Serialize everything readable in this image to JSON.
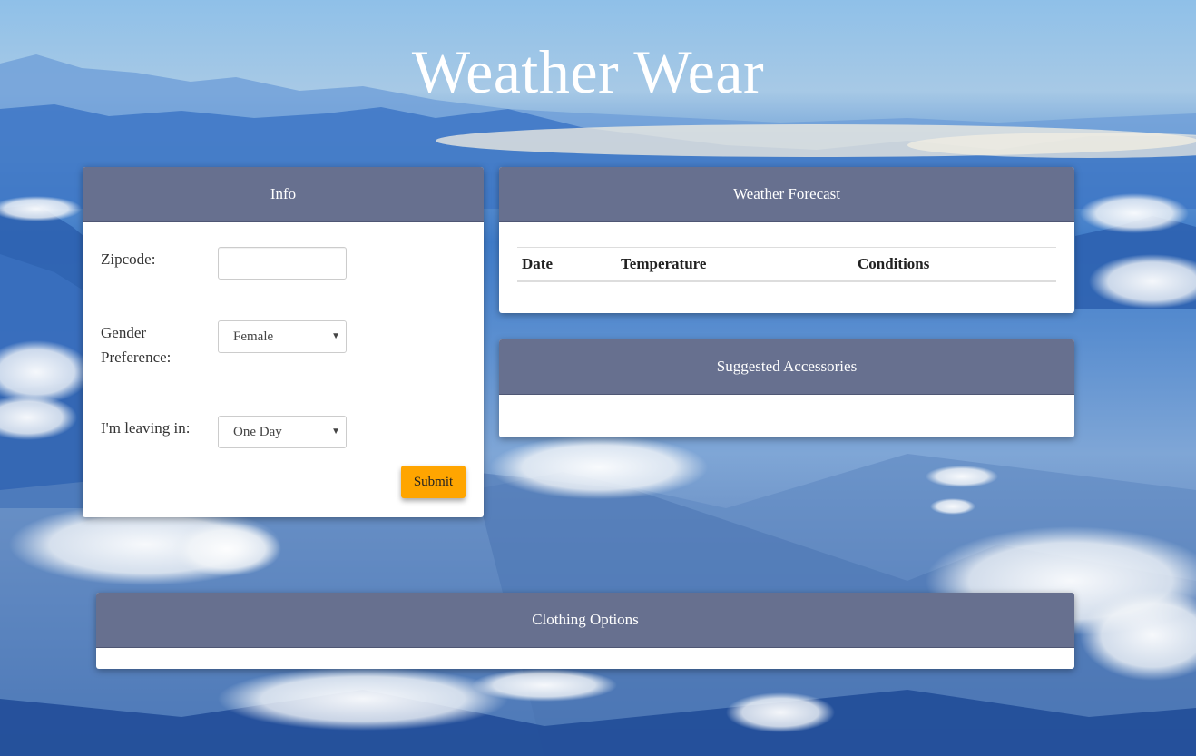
{
  "app": {
    "title": "Weather Wear"
  },
  "info": {
    "header": "Info",
    "zipcode_label": "Zipcode:",
    "zipcode_value": "",
    "gender_label": "Gender Preference:",
    "gender_selected": "Female",
    "leaving_label": "I'm leaving in:",
    "leaving_selected": "One Day",
    "submit_label": "Submit"
  },
  "forecast": {
    "header": "Weather Forecast",
    "columns": [
      "Date",
      "Temperature",
      "Conditions"
    ]
  },
  "accessories": {
    "header": "Suggested Accessories"
  },
  "clothing": {
    "header": "Clothing Options"
  },
  "colors": {
    "panel_header": "#67708f",
    "submit_button": "#ffa500",
    "title_text": "#ffffff"
  }
}
